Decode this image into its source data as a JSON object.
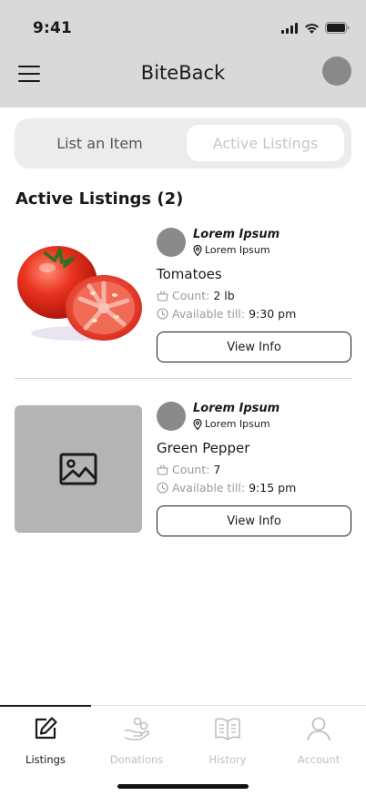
{
  "status_bar": {
    "time": "9:41"
  },
  "header": {
    "title": "BiteBack"
  },
  "tabs": [
    {
      "label": "List an Item",
      "active": false
    },
    {
      "label": "Active Listings",
      "active": true
    }
  ],
  "section": {
    "title": "Active Listings (2)"
  },
  "listings": [
    {
      "owner_name": "Lorem Ipsum",
      "owner_location": "Lorem Ipsum",
      "item_name": "Tomatoes",
      "count_label": "Count:",
      "count_value": "2 lb",
      "available_label": "Available till:",
      "available_value": "9:30 pm",
      "button_label": "View Info",
      "image": "tomato-photo"
    },
    {
      "owner_name": "Lorem Ipsum",
      "owner_location": "Lorem Ipsum",
      "item_name": "Green Pepper",
      "count_label": "Count:",
      "count_value": "7",
      "available_label": "Available till:",
      "available_value": "9:15 pm",
      "button_label": "View Info",
      "image": "image-placeholder-icon"
    }
  ],
  "bottom_nav": [
    {
      "label": "Listings",
      "icon": "edit-icon",
      "active": true
    },
    {
      "label": "Donations",
      "icon": "donate-hand-icon",
      "active": false
    },
    {
      "label": "History",
      "icon": "book-icon",
      "active": false
    },
    {
      "label": "Account",
      "icon": "user-icon",
      "active": false
    }
  ],
  "colors": {
    "header_bg": "#d9d9d9",
    "avatar": "#8a8a8a",
    "placeholder": "#b4b4b4",
    "inactive_text": "#c0c0c0",
    "accent": "#1a1a1a"
  }
}
